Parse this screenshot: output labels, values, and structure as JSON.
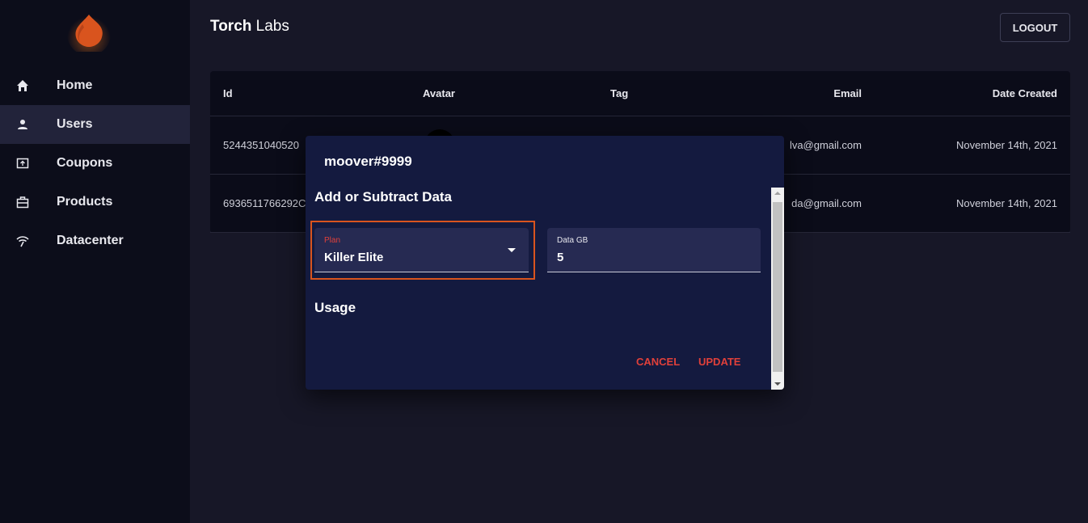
{
  "app": {
    "brand_bold": "Torch",
    "brand_rest": " Labs",
    "logout_label": "LOGOUT"
  },
  "sidebar": {
    "items": [
      {
        "label": "Home",
        "icon": "home-icon",
        "active": false
      },
      {
        "label": "Users",
        "icon": "user-icon",
        "active": true
      },
      {
        "label": "Coupons",
        "icon": "coupon-icon",
        "active": false
      },
      {
        "label": "Products",
        "icon": "briefcase-icon",
        "active": false
      },
      {
        "label": "Datacenter",
        "icon": "wifi-icon",
        "active": false
      }
    ]
  },
  "table": {
    "headers": {
      "id": "Id",
      "avatar": "Avatar",
      "tag": "Tag",
      "email": "Email",
      "date": "Date Created"
    },
    "rows": [
      {
        "id": "5244351040520",
        "email": "lva@gmail.com",
        "date": "November 14th, 2021"
      },
      {
        "id": "6936511766292C",
        "email": "da@gmail.com",
        "date": "November 14th, 2021"
      }
    ]
  },
  "dialog": {
    "title": "moover#9999",
    "subtitle": "Add or Subtract Data",
    "plan_label": "Plan",
    "plan_value": "Killer Elite",
    "data_label": "Data GB",
    "data_value": "5",
    "usage_heading": "Usage",
    "cancel_label": "CANCEL",
    "update_label": "UPDATE"
  },
  "colors": {
    "accent": "#e0403a",
    "highlight": "#d9541e",
    "dialog_bg": "#141a3f",
    "sidebar_bg": "#0c0d1a"
  }
}
